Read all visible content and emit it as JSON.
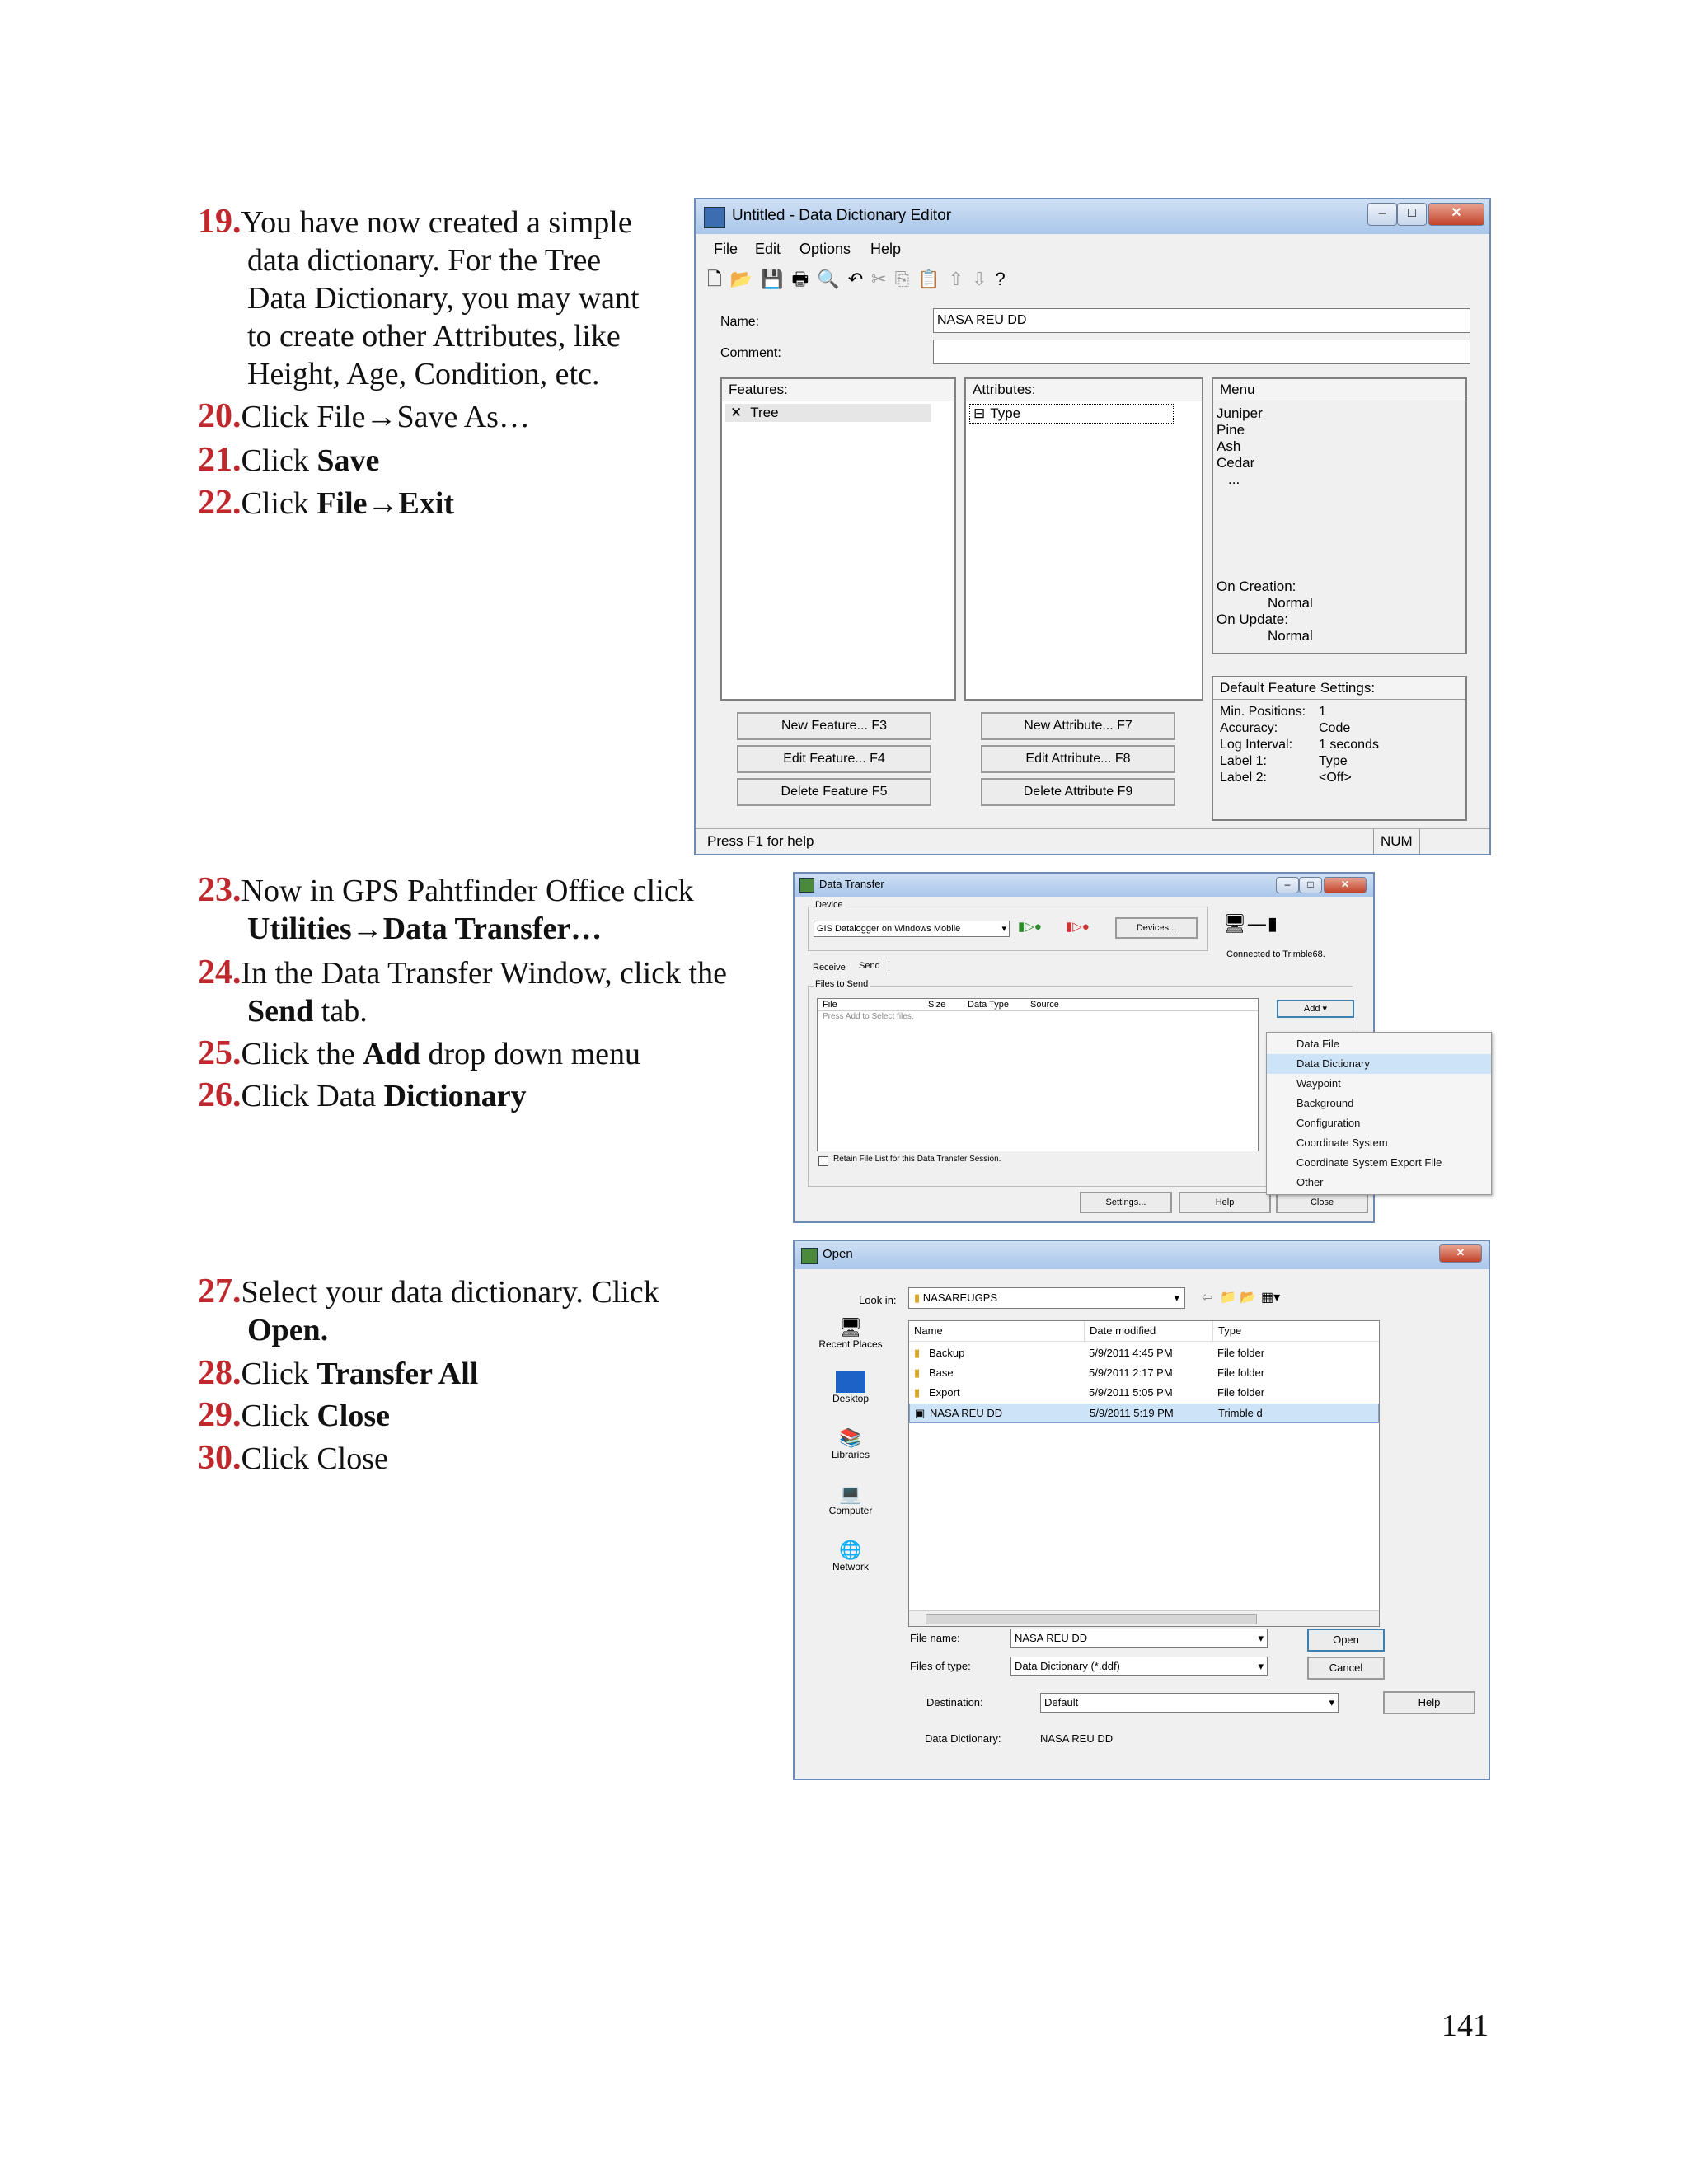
{
  "steps": {
    "s19": {
      "num": "19.",
      "l1": "You have now created a simple",
      "l2": "data dictionary.  For the Tree",
      "l3": "Data Dictionary, you may want",
      "l4": "to create other Attributes, like",
      "l5": "Height, Age, Condition, etc."
    },
    "s20": {
      "num": "20.",
      "text": "Click File→Save As…"
    },
    "s21": {
      "num": "21.",
      "pre": "Click ",
      "bold": "Save"
    },
    "s22": {
      "num": "22.",
      "pre": "Click ",
      "bold": "File→Exit"
    },
    "s23": {
      "num": "23.",
      "l1": "Now in GPS Pahtfinder Office click",
      "l2": "Utilities→Data Transfer…"
    },
    "s24": {
      "num": "24.",
      "l1": "In the Data Transfer Window, click the",
      "l2b": "Send",
      "l2": " tab."
    },
    "s25": {
      "num": "25.",
      "pre": "Click the ",
      "bold": "Add",
      "post": " drop down menu"
    },
    "s26": {
      "num": "26.",
      "pre": "Click Data ",
      "bold": "Dictionary"
    },
    "s27": {
      "num": "27.",
      "l1": "Select your data dictionary.  Click",
      "l2": "Open."
    },
    "s28": {
      "num": "28.",
      "pre": "Click ",
      "bold": "Transfer All"
    },
    "s29": {
      "num": "29.",
      "pre": "Click ",
      "bold": "Close"
    },
    "s30": {
      "num": "30.",
      "text": "Click Close"
    }
  },
  "page_number": "141",
  "dde": {
    "title": "Untitled - Data Dictionary Editor",
    "menu": [
      "File",
      "Edit",
      "Options",
      "Help"
    ],
    "name_label": "Name:",
    "name_value": "NASA REU DD",
    "comment_label": "Comment:",
    "features_header": "Features:",
    "feature_item": "Tree",
    "attributes_header": "Attributes:",
    "attribute_item": "Type",
    "menu_header": "Menu",
    "menu_values": [
      "Juniper",
      "Pine",
      "Ash",
      "Cedar",
      "..."
    ],
    "on_creation": "On Creation:",
    "on_creation_val": "Normal",
    "on_update": "On Update:",
    "on_update_val": "Normal",
    "defaults_header": "Default Feature Settings:",
    "defaults": [
      {
        "k": "Min. Positions:",
        "v": "1"
      },
      {
        "k": "Accuracy:",
        "v": "Code"
      },
      {
        "k": "Log Interval:",
        "v": "1 seconds"
      },
      {
        "k": "Label 1:",
        "v": "Type"
      },
      {
        "k": "Label 2:",
        "v": "<Off>"
      }
    ],
    "btn_new_feature": "New Feature... F3",
    "btn_edit_feature": "Edit Feature... F4",
    "btn_delete_feature": "Delete Feature F5",
    "btn_new_attr": "New Attribute... F7",
    "btn_edit_attr": "Edit Attribute... F8",
    "btn_delete_attr": "Delete Attribute F9",
    "status": "Press F1 for help",
    "num": "NUM"
  },
  "transfer": {
    "title": "Data Transfer",
    "device_label": "Device",
    "device_value": "GIS Datalogger on Windows Mobile",
    "devices_btn": "Devices...",
    "connected": "Connected to Trimble68.",
    "tab_receive": "Receive",
    "tab_send": "Send",
    "files_label": "Files to Send",
    "cols": [
      "File",
      "Size",
      "Data Type",
      "Source"
    ],
    "hint": "Press Add to Select files.",
    "add_btn": "Add",
    "add_menu": [
      "Data File",
      "Data Dictionary",
      "Waypoint",
      "Background",
      "Configuration",
      "Coordinate System",
      "Coordinate System Export File",
      "Other"
    ],
    "retain": "Retain File List for this Data Transfer Session.",
    "settings_btn": "Settings...",
    "help_btn": "Help",
    "close_btn": "Close"
  },
  "open": {
    "title": "Open",
    "look_in_label": "Look in:",
    "look_in_value": "NASAREUGPS",
    "places": [
      "Recent Places",
      "Desktop",
      "Libraries",
      "Computer",
      "Network"
    ],
    "cols": [
      "Name",
      "Date modified",
      "Type"
    ],
    "rows": [
      {
        "name": "Backup",
        "date": "5/9/2011 4:45 PM",
        "type": "File folder"
      },
      {
        "name": "Base",
        "date": "5/9/2011 2:17 PM",
        "type": "File folder"
      },
      {
        "name": "Export",
        "date": "5/9/2011 5:05 PM",
        "type": "File folder"
      },
      {
        "name": "NASA REU DD",
        "date": "5/9/2011 5:19 PM",
        "type": "Trimble d"
      }
    ],
    "file_name_label": "File name:",
    "file_name_value": "NASA REU DD",
    "files_of_type_label": "Files of type:",
    "files_of_type_value": "Data Dictionary (*.ddf)",
    "destination_label": "Destination:",
    "destination_value": "Default",
    "dd_label": "Data Dictionary:",
    "dd_value": "NASA REU DD",
    "open_btn": "Open",
    "cancel_btn": "Cancel",
    "help_btn": "Help"
  },
  "colors": {
    "step_number": "#c0282d",
    "title_bar": "#a9c6ea",
    "selection": "#cde3f8"
  }
}
